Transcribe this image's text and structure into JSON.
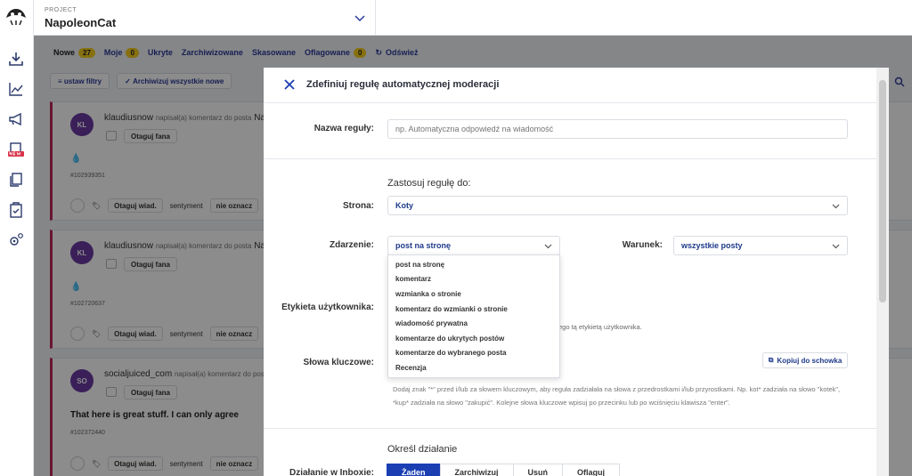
{
  "header": {
    "project_label": "PROJECT",
    "project_name": "NapoleonCat"
  },
  "tabs": [
    {
      "label": "Nowe",
      "count": "27"
    },
    {
      "label": "Moje",
      "count": "0"
    },
    {
      "label": "Ukryte"
    },
    {
      "label": "Zarchiwizowane"
    },
    {
      "label": "Skasowane"
    },
    {
      "label": "Oflagowane",
      "count": "0"
    },
    {
      "label": "Odśwież"
    }
  ],
  "toolbar": {
    "filters": "ustaw filtry",
    "archive_all": "Archiwizuj wszystkie nowe"
  },
  "cards": [
    {
      "initials": "KL",
      "author": "klaudiusnow",
      "action": "napisał(a) komentarz do posta",
      "post": "Na",
      "tag": "Otaguj fana",
      "body": "💧",
      "id": "#102939351",
      "tag_msg": "Otaguj wiad.",
      "sentiment": "sentyment",
      "mark": "nie oznacz"
    },
    {
      "initials": "KL",
      "author": "klaudiusnow",
      "action": "napisał(a) komentarz do posta",
      "post": "Na",
      "tag": "Otaguj fana",
      "body": "💧",
      "id": "#102720637",
      "tag_msg": "Otaguj wiad.",
      "sentiment": "sentyment",
      "mark": "nie oznacz"
    },
    {
      "initials": "SO",
      "author": "socialjuiced_com",
      "action": "napisał(a) komentarz do posta",
      "post": "Na",
      "tag": "Otaguj fana",
      "body": "That here is great stuff. I can only agree",
      "id": "#102372440",
      "tag_msg": "Otaguj wiad.",
      "sentiment": "sentyment",
      "mark": "nie oznacz"
    }
  ],
  "modal": {
    "title": "Zdefiniuj regułę automatycznej moderacji",
    "rule_name_label": "Nazwa reguły:",
    "rule_name_placeholder": "np. Automatyczna odpowiedź na wiadomość",
    "apply_heading": "Zastosuj regułę do:",
    "page_label": "Strona:",
    "page_value": "Koty",
    "event_label": "Zdarzenie:",
    "event_value": "post na stronę",
    "condition_label": "Warunek:",
    "condition_value": "wszystkie posty",
    "event_options": [
      "post na stronę",
      "komentarz",
      "wzmianka o stronie",
      "komentarz do wzmianki o stronie",
      "wiadomość prywatna",
      "komentarze do ukrytych postów",
      "komentarze do wybranego posta",
      "Recenzja"
    ],
    "user_tag_label": "Etykieta użytkownika:",
    "user_tag_note": "ego tą etykietą użytkownika.",
    "keywords_label": "Słowa kluczowe:",
    "copy_button": "Kopiuj do schowka",
    "keywords_hint": "Dodaj znak \"*\" przed i/lub za słowem kluczowym, aby reguła zadziałała na słowa z przedrostkami i/lub przyrostkami. Np. kot* zadziała na słowo \"kotek\", *kup* zadziała na słowo \"zakupić\". Kolejne słowa kluczowe wpisuj po przecinku lub po wciśnięciu klawisza \"enter\".",
    "action_heading": "Określ działanie",
    "inbox_action_label": "Działanie w Inboxie:",
    "inbox_actions": [
      "Żaden",
      "Zarchiwizuj",
      "Usuń",
      "Oflaguj"
    ]
  },
  "colors": {
    "accent": "#1b3fb3",
    "brand_text": "#1e3a8a",
    "card_border": "#c1275a",
    "badge": "#f5cd1c",
    "avatar": "#6b3aa3"
  }
}
